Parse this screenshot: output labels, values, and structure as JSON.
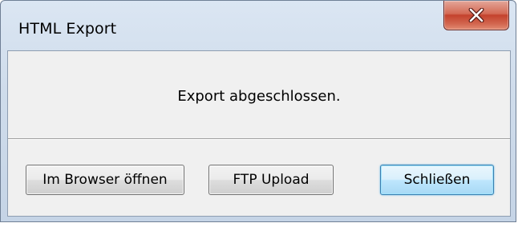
{
  "window": {
    "title": "HTML Export"
  },
  "titlebar": {
    "close_icon": "close-icon"
  },
  "message": {
    "text": "Export abgeschlossen."
  },
  "buttons": {
    "open_browser": "Im Browser öffnen",
    "ftp_upload": "FTP Upload",
    "close": "Schließen"
  },
  "colors": {
    "close_button_red": "#c4422d",
    "default_button_blue": "#3c7fb1",
    "frame": "#cfdceb",
    "client_background": "#f0f0f0"
  }
}
